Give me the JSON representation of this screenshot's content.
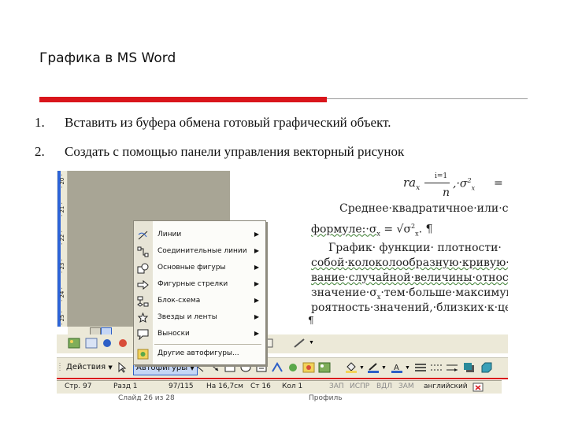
{
  "slide": {
    "title": "Графика в MS Word",
    "items": [
      {
        "num": "1.",
        "text": "Вставить из буфера обмена готовый графический объект."
      },
      {
        "num": "2.",
        "text": "Создать с помощью панели управления векторный рисунок"
      }
    ]
  },
  "ruler": {
    "labels": [
      "· 20 ·",
      "· 21 ·",
      "· 22 ·",
      "· 23 ·",
      "· 24 ·",
      "· 25 ·"
    ]
  },
  "document": {
    "formula_top_left": "ra",
    "formula_sub": "x",
    "formula_sum_index": "i=1",
    "formula_n": "n",
    "formula_sigma": ",·σ",
    "formula_sigma_sup": "2",
    "formula_sigma_sub": "x",
    "formula_eq": "= ",
    "lines": [
      "Среднее·квадратичное·или·ст",
      "формуле:·σ",
      "График· функции· плотности·",
      "собой·колоколообразную·кривую·",
      "вание·случайной·величины·относи",
      "значение·σ",
      "роятность·значений,·близких·к·цен"
    ],
    "line2_tail": " = √σ",
    "line2_end": ". ¶",
    "line6_sub": "x",
    "line6_tail": "·тем·больше·максимум",
    "pilcrow": "¶"
  },
  "autoshapes_menu": {
    "items": [
      {
        "label": "Линии",
        "icon": "lines-icon"
      },
      {
        "label": "Соединительные линии",
        "icon": "connectors-icon"
      },
      {
        "label": "Основные фигуры",
        "icon": "basic-shapes-icon"
      },
      {
        "label": "Фигурные стрелки",
        "icon": "block-arrows-icon"
      },
      {
        "label": "Блок-схема",
        "icon": "flowchart-icon"
      },
      {
        "label": "Звезды и ленты",
        "icon": "stars-banners-icon"
      },
      {
        "label": "Выноски",
        "icon": "callouts-icon"
      }
    ],
    "more_label": "Другие автофигуры...",
    "submenu_arrow": "▶"
  },
  "drawing_toolbar": {
    "actions_label": "Действия",
    "autoshapes_label": "Автофигуры",
    "dropdown_arrow": "▼"
  },
  "statusbar": {
    "page": "Стр. 97",
    "section": "Разд 1",
    "pages": "97/115",
    "at": "На 16,7см",
    "line": "Ст 16",
    "col": "Кол 1",
    "rec": "ЗАП",
    "trk": "ИСПР",
    "ext": "ВДЛ",
    "ovr": "ЗАМ",
    "lang": "английский"
  },
  "taskbar": {
    "slide_info": "Слайд 26 из 28",
    "profile": "Профиль"
  },
  "colors": {
    "accent_red": "#d9151b",
    "toolbar_bg": "#ece9d8",
    "grey_area": "#a8a595"
  }
}
